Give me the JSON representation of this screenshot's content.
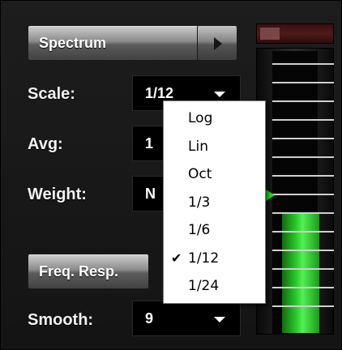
{
  "spectrum": {
    "label": "Spectrum"
  },
  "scale": {
    "label": "Scale:",
    "value": "1/12"
  },
  "avg": {
    "label": "Avg:",
    "value": "1"
  },
  "weight": {
    "label": "Weight:",
    "value": "N"
  },
  "freq_resp": {
    "label": "Freq. Resp."
  },
  "smooth": {
    "label": "Smooth:",
    "value": "9"
  },
  "scale_menu": {
    "items": [
      {
        "label": "Log",
        "checked": false
      },
      {
        "label": "Lin",
        "checked": false
      },
      {
        "label": "Oct",
        "checked": false
      },
      {
        "label": "1/3",
        "checked": false
      },
      {
        "label": "1/6",
        "checked": false
      },
      {
        "label": "1/12",
        "checked": true
      },
      {
        "label": "1/24",
        "checked": false
      }
    ],
    "check_mark": "✔"
  },
  "meter": {
    "level": 0.42,
    "accent_color": "#2ecf2e",
    "peak_color": "#4e1a1a"
  },
  "icons": {
    "menu_arrow": "triangle-right-icon",
    "dropdown_caret": "chevron-down-icon"
  }
}
